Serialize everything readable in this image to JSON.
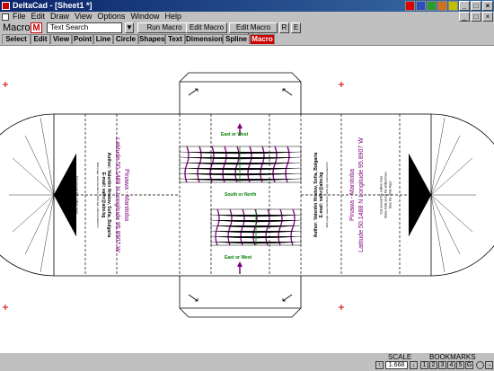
{
  "window": {
    "title": "DeltaCad - [Sheet1 *]"
  },
  "menu": [
    "File",
    "Edit",
    "Draw",
    "View",
    "Options",
    "Window",
    "Help"
  ],
  "macro_bar": {
    "label": "Macro",
    "logo": "M",
    "search_value": "Text Search",
    "run_button": "Run Macro",
    "edit_button": "Edit Macro",
    "list_button": "Edit Macro List",
    "r_button": "R",
    "e_button": "E"
  },
  "tabs": [
    "Select",
    "Edit",
    "View",
    "Point",
    "Line",
    "Circle",
    "Shapes",
    "Text",
    "Dimension",
    "Spline",
    "Macro"
  ],
  "active_tab": "Macro",
  "drawing": {
    "place": "Pinawa - Manitoba",
    "coords": "Latitude 50.1488 N  Longitude 95.8907 W",
    "author": "Author: Valentin Hristov, Sofia, Bulgaria",
    "email": "E-mail: valhr@abv.bg",
    "web": "Web page: www.members.chello.bg/~valhr/sundial.htm",
    "cut_note": "Cut around the outline lines",
    "fold_note": "Make folds along the dotted lines",
    "glue_note": "Glue the white flaps",
    "east_west": "East or West",
    "south_north": "South or North"
  },
  "status": {
    "scale_label": "SCALE",
    "scale_value": "1.668",
    "bookmarks_label": "BOOKMARKS",
    "bookmarks": [
      "1",
      "2",
      "3",
      "4",
      "5"
    ],
    "bookmark_action": "G"
  },
  "colors": {
    "title_gradient_start": "#0a246a",
    "title_gradient_end": "#3a6ea5",
    "accent": "#cc0000",
    "purple": "#800080",
    "green": "#008000"
  }
}
